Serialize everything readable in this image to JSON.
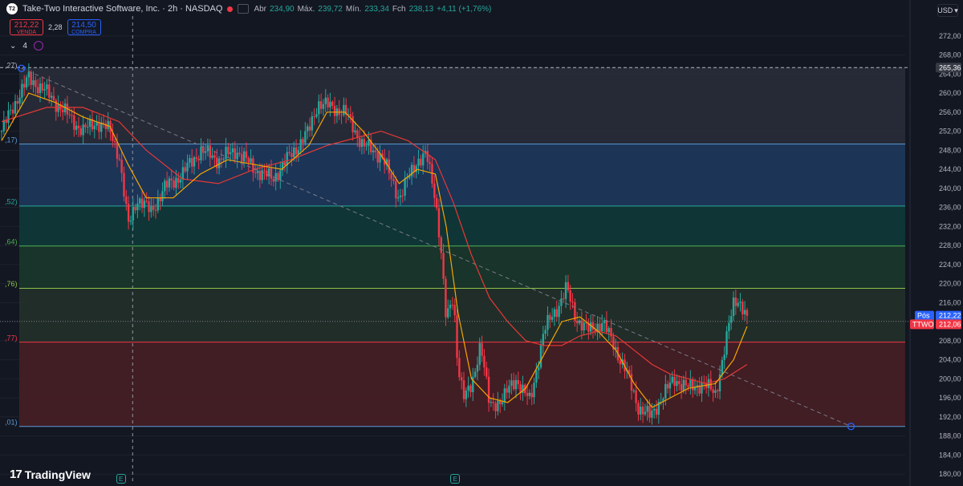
{
  "header": {
    "symbol_icon": "T2",
    "title": "Take-Two Interactive Software, Inc. · 2h · NASDAQ",
    "ohlc": [
      {
        "k": "Abr",
        "v": "234,90"
      },
      {
        "k": "Máx.",
        "v": "239,72"
      },
      {
        "k": "Mín.",
        "v": "233,34"
      },
      {
        "k": "Fch",
        "v": "238,13"
      },
      {
        "k": "",
        "v": "+4,11 (+1,76%)"
      }
    ]
  },
  "trade": {
    "sell_price": "212,22",
    "sell_label": "VENDA",
    "spread": "2,28",
    "buy_price": "214,50",
    "buy_label": "COMPRA"
  },
  "indicators": {
    "collapse": "⌄",
    "count": "4"
  },
  "currency": "USD",
  "logo": {
    "mark": "17",
    "text": "TradingView"
  },
  "colors": {
    "background": "#131722",
    "up": "#26a69a",
    "down": "#f23645",
    "ma_fast": "#f7a600",
    "ma_slow": "#e53935",
    "grid": "#1e222d"
  },
  "chart_data": {
    "type": "candlestick",
    "y_axis": {
      "ticks": [
        272,
        268,
        264,
        260,
        256,
        252,
        248,
        244,
        240,
        236,
        232,
        228,
        224,
        220,
        216,
        212,
        208,
        204,
        200,
        196,
        192,
        188,
        184,
        180
      ],
      "tick_labels": [
        "272,00",
        "268,00",
        "264,00",
        "260,00",
        "256,00",
        "252,00",
        "248,00",
        "244,00",
        "240,00",
        "236,00",
        "232,00",
        "228,00",
        "224,00",
        "220,00",
        "216,00",
        "212,00",
        "208,00",
        "204,00",
        "200,00",
        "196,00",
        "192,00",
        "188,00",
        "184,00",
        "180,00"
      ],
      "range": [
        178.5,
        274.5
      ]
    },
    "price_labels": [
      {
        "text": "265,36",
        "value": 265.36,
        "style": "dark"
      },
      {
        "text": "212,22",
        "value": 213.25,
        "style": "blue",
        "prefix": "Pós"
      },
      {
        "text": "212,06",
        "value": 211.45,
        "style": "red",
        "prefix": "TTWO"
      }
    ],
    "fib_zones": [
      {
        "top": 265.36,
        "bottom": 249.3,
        "color": "#2a2e39"
      },
      {
        "top": 249.3,
        "bottom": 236.3,
        "color": "#1e3a5f"
      },
      {
        "top": 236.3,
        "bottom": 227.9,
        "color": "#0f3b3a"
      },
      {
        "top": 227.9,
        "bottom": 219.0,
        "color": "#1b3a2c"
      },
      {
        "top": 219.0,
        "bottom": 207.7,
        "color": "#24312a"
      },
      {
        "top": 207.7,
        "bottom": 190.0,
        "color": "#4a1f24"
      }
    ],
    "fib_lines": [
      {
        "value": 249.3,
        "color": "#5b9bd5"
      },
      {
        "value": 236.3,
        "color": "#26a69a"
      },
      {
        "value": 227.9,
        "color": "#4caf50"
      },
      {
        "value": 219.0,
        "color": "#8bc34a"
      },
      {
        "value": 207.7,
        "color": "#f23645"
      },
      {
        "value": 190.0,
        "color": "#5b9bd5"
      }
    ],
    "fib_left_labels": [
      {
        "text": ",27)",
        "value": 265.8,
        "color": "#b2b5be"
      },
      {
        "text": ",17)",
        "value": 250.2,
        "color": "#5b9bd5"
      },
      {
        "text": ",52)",
        "value": 237.2,
        "color": "#26a69a"
      },
      {
        "text": ",64)",
        "value": 228.8,
        "color": "#4caf50"
      },
      {
        "text": ",76)",
        "value": 219.9,
        "color": "#8bc34a"
      },
      {
        "text": ",77)",
        "value": 208.6,
        "color": "#f23645"
      },
      {
        "text": ",01)",
        "value": 190.9,
        "color": "#5b9bd5"
      }
    ],
    "trendline": {
      "from": [
        0.022,
        265.2
      ],
      "to": [
        0.94,
        190.0
      ]
    },
    "crosshair_x": 0.145,
    "anchors": [
      {
        "x": 0.022,
        "y": 265.2
      },
      {
        "x": 0.94,
        "y": 190.0
      }
    ],
    "events": [
      {
        "text": "E",
        "x": 0.132
      },
      {
        "text": "E",
        "x": 0.502
      }
    ],
    "closes_path": [
      [
        0.0,
        252
      ],
      [
        0.02,
        260
      ],
      [
        0.03,
        263
      ],
      [
        0.045,
        261
      ],
      [
        0.06,
        258
      ],
      [
        0.075,
        255
      ],
      [
        0.09,
        252
      ],
      [
        0.105,
        254
      ],
      [
        0.12,
        252
      ],
      [
        0.13,
        247
      ],
      [
        0.14,
        232
      ],
      [
        0.15,
        238
      ],
      [
        0.165,
        235
      ],
      [
        0.18,
        240
      ],
      [
        0.2,
        243
      ],
      [
        0.22,
        248
      ],
      [
        0.24,
        246
      ],
      [
        0.26,
        248
      ],
      [
        0.28,
        244
      ],
      [
        0.3,
        242
      ],
      [
        0.32,
        247
      ],
      [
        0.34,
        252
      ],
      [
        0.35,
        258
      ],
      [
        0.365,
        257
      ],
      [
        0.38,
        256
      ],
      [
        0.4,
        249
      ],
      [
        0.42,
        247
      ],
      [
        0.44,
        238
      ],
      [
        0.45,
        242
      ],
      [
        0.46,
        246
      ],
      [
        0.47,
        247
      ],
      [
        0.48,
        238
      ],
      [
        0.486,
        228
      ],
      [
        0.492,
        212
      ],
      [
        0.5,
        217
      ],
      [
        0.505,
        203
      ],
      [
        0.512,
        196
      ],
      [
        0.52,
        198
      ],
      [
        0.53,
        208
      ],
      [
        0.54,
        194
      ],
      [
        0.555,
        196
      ],
      [
        0.57,
        200
      ],
      [
        0.585,
        195
      ],
      [
        0.6,
        210
      ],
      [
        0.615,
        215
      ],
      [
        0.625,
        219
      ],
      [
        0.635,
        213
      ],
      [
        0.65,
        210
      ],
      [
        0.665,
        212
      ],
      [
        0.68,
        206
      ],
      [
        0.69,
        202
      ],
      [
        0.705,
        194
      ],
      [
        0.718,
        192
      ],
      [
        0.73,
        196
      ],
      [
        0.745,
        200
      ],
      [
        0.76,
        198
      ],
      [
        0.775,
        199
      ],
      [
        0.79,
        197
      ],
      [
        0.8,
        206
      ],
      [
        0.81,
        216
      ],
      [
        0.815,
        217
      ],
      [
        0.822,
        214
      ],
      [
        0.825,
        212
      ]
    ],
    "ma_fast_path": [
      [
        0.0,
        250
      ],
      [
        0.03,
        260
      ],
      [
        0.06,
        258
      ],
      [
        0.09,
        255
      ],
      [
        0.12,
        253
      ],
      [
        0.14,
        245
      ],
      [
        0.16,
        238
      ],
      [
        0.19,
        238
      ],
      [
        0.22,
        243
      ],
      [
        0.25,
        246
      ],
      [
        0.28,
        245
      ],
      [
        0.31,
        244
      ],
      [
        0.34,
        249
      ],
      [
        0.36,
        256
      ],
      [
        0.38,
        256
      ],
      [
        0.4,
        252
      ],
      [
        0.42,
        247
      ],
      [
        0.44,
        241
      ],
      [
        0.46,
        244
      ],
      [
        0.48,
        243
      ],
      [
        0.492,
        232
      ],
      [
        0.505,
        214
      ],
      [
        0.52,
        200
      ],
      [
        0.54,
        196
      ],
      [
        0.56,
        195
      ],
      [
        0.58,
        198
      ],
      [
        0.6,
        205
      ],
      [
        0.62,
        212
      ],
      [
        0.64,
        213
      ],
      [
        0.66,
        210
      ],
      [
        0.68,
        206
      ],
      [
        0.7,
        199
      ],
      [
        0.72,
        194
      ],
      [
        0.74,
        196
      ],
      [
        0.76,
        198
      ],
      [
        0.79,
        199
      ],
      [
        0.81,
        204
      ],
      [
        0.825,
        211
      ]
    ],
    "ma_slow_path": [
      [
        0.0,
        254
      ],
      [
        0.05,
        257
      ],
      [
        0.09,
        257
      ],
      [
        0.13,
        254
      ],
      [
        0.16,
        248
      ],
      [
        0.2,
        242
      ],
      [
        0.24,
        241
      ],
      [
        0.28,
        244
      ],
      [
        0.32,
        246
      ],
      [
        0.36,
        249
      ],
      [
        0.4,
        251
      ],
      [
        0.42,
        252
      ],
      [
        0.45,
        250
      ],
      [
        0.48,
        246
      ],
      [
        0.5,
        237
      ],
      [
        0.52,
        226
      ],
      [
        0.54,
        217
      ],
      [
        0.56,
        212
      ],
      [
        0.58,
        208
      ],
      [
        0.6,
        207
      ],
      [
        0.62,
        207
      ],
      [
        0.64,
        209
      ],
      [
        0.66,
        210
      ],
      [
        0.68,
        209
      ],
      [
        0.7,
        206
      ],
      [
        0.72,
        203
      ],
      [
        0.74,
        201
      ],
      [
        0.76,
        200
      ],
      [
        0.78,
        199
      ],
      [
        0.8,
        200
      ],
      [
        0.825,
        203
      ]
    ]
  }
}
